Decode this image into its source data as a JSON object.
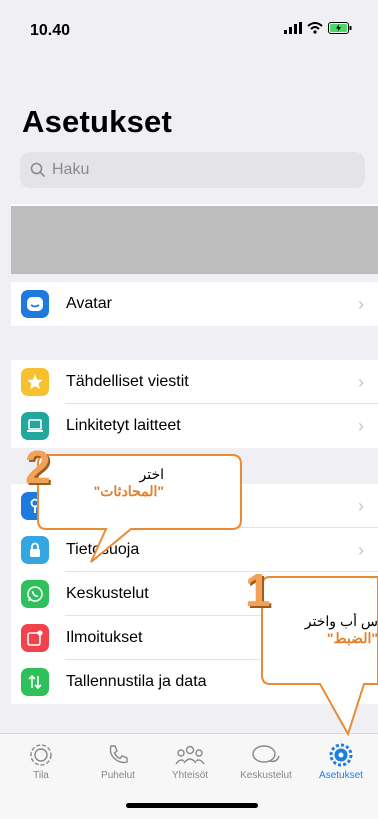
{
  "status_bar": {
    "time": "10.40"
  },
  "header": {
    "title": "Asetukset"
  },
  "search": {
    "placeholder": "Haku"
  },
  "rows": {
    "avatar": "Avatar",
    "starred": "Tähdelliset viestit",
    "linked": "Linkitetyt laitteet",
    "privacy": "Tietosuoja",
    "chats": "Keskustelut",
    "notifications": "Ilmoitukset",
    "storage": "Tallennustila ja data"
  },
  "tabs": {
    "tila": "Tila",
    "puhelut": "Puhelut",
    "yhteisot": "Yhteisöt",
    "keskustelut": "Keskustelut",
    "asetukset": "Asetukset"
  },
  "callouts": {
    "one": {
      "number": "1",
      "line1": "ِس أب واختر",
      "line2": "\"الضبط\""
    },
    "two": {
      "number": "2",
      "line1": "اختر",
      "line2": "\"المحادثات\""
    }
  },
  "colors": {
    "accent": "#1b7fe3",
    "callout": "#f0a256"
  }
}
